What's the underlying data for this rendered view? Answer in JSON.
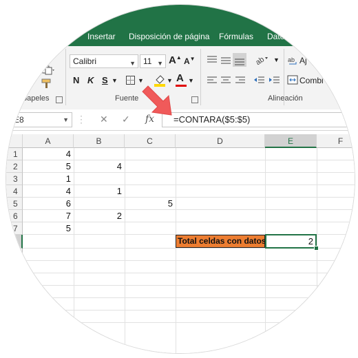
{
  "ribbon": {
    "tabs": [
      "Insertar",
      "Disposición de página",
      "Fórmulas",
      "Dato"
    ],
    "font_name": "Calibri",
    "font_size": "11",
    "bold": "N",
    "italic": "K",
    "underline": "S",
    "font_color_letter": "A",
    "wrap_partial": "Aj",
    "merge_partial": "Combi",
    "groups": {
      "clipboard": "papeles",
      "font": "Fuente",
      "alignment": "Alineación"
    },
    "colors": {
      "tab_bg": "#217346",
      "ribbon_bg": "#f3f3f3",
      "fill_yellow": "#ffd800",
      "font_red": "#e00000"
    }
  },
  "formula_bar": {
    "name_box": "E8",
    "fx": "fx",
    "formula": "=CONTARA($5:$5)"
  },
  "sheet": {
    "columns": [
      "A",
      "B",
      "C",
      "D",
      "E",
      "F"
    ],
    "selected_column": "E",
    "rows": [
      "1",
      "2",
      "3",
      "4",
      "5",
      "6",
      "7"
    ],
    "cells": {
      "A1": "4",
      "A2": "5",
      "A3": "1",
      "A4": "4",
      "A5": "6",
      "A6": "7",
      "A7": "5",
      "B2": "4",
      "B4": "1",
      "B6": "2",
      "C5": "5"
    },
    "label": "Total celdas con datos",
    "result": "2",
    "colors": {
      "label_bg": "#ed7d31",
      "selection": "#217346"
    }
  }
}
